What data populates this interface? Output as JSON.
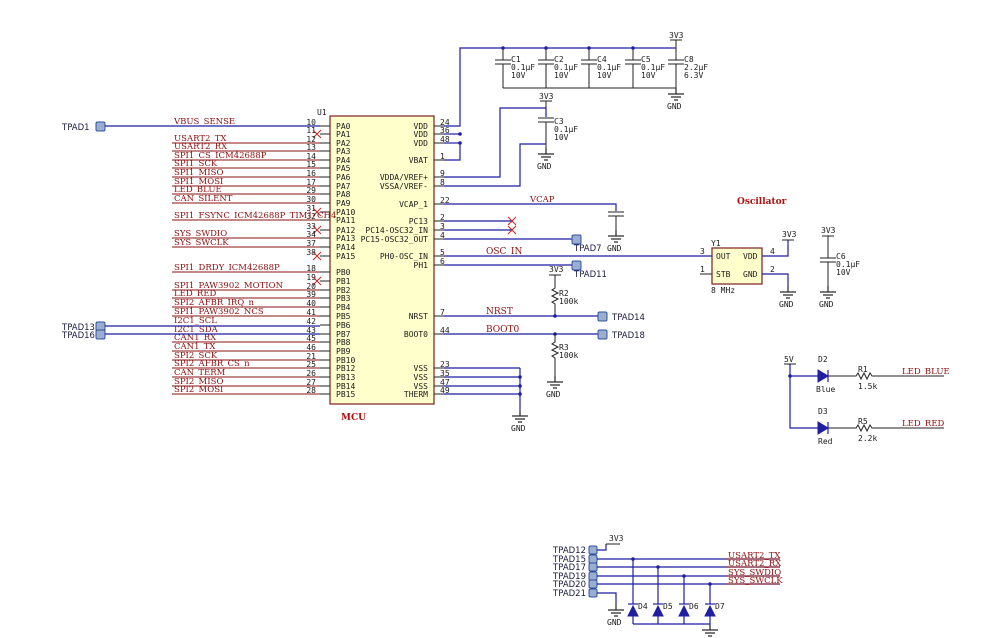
{
  "mcu": {
    "ref": "U1",
    "title": "MCU",
    "left_pins": [
      {
        "name": "PA0",
        "num": "10",
        "net": "VBUS_SENSE"
      },
      {
        "name": "PA1",
        "num": "11",
        "net": ""
      },
      {
        "name": "PA2",
        "num": "12",
        "net": "USART2_TX"
      },
      {
        "name": "PA3",
        "num": "13",
        "net": "USART2_RX"
      },
      {
        "name": "PA4",
        "num": "14",
        "net": "SPI1_CS_ICM42688P"
      },
      {
        "name": "PA5",
        "num": "15",
        "net": "SPI1_SCK"
      },
      {
        "name": "PA6",
        "num": "16",
        "net": "SPI1_MISO"
      },
      {
        "name": "PA7",
        "num": "17",
        "net": "SPI1_MOSI"
      },
      {
        "name": "PA8",
        "num": "29",
        "net": "LED_BLUE"
      },
      {
        "name": "PA9",
        "num": "30",
        "net": "CAN_SILENT"
      },
      {
        "name": "PA10",
        "num": "31",
        "net": ""
      },
      {
        "name": "PA11",
        "num": "32",
        "net": "SPI1_FSYNC_ICM42688P_TIM1_CH4"
      },
      {
        "name": "PA12",
        "num": "33",
        "net": ""
      },
      {
        "name": "PA13",
        "num": "34",
        "net": "SYS_SWDIO"
      },
      {
        "name": "PA14",
        "num": "37",
        "net": "SYS_SWCLK"
      },
      {
        "name": "PA15",
        "num": "38",
        "net": ""
      },
      {
        "name": "PB0",
        "num": "18",
        "net": "SPI1_DRDY_ICM42688P"
      },
      {
        "name": "PB1",
        "num": "19",
        "net": ""
      },
      {
        "name": "PB2",
        "num": "20",
        "net": "SPI1_PAW3902_MOTION"
      },
      {
        "name": "PB3",
        "num": "39",
        "net": "LED_RED"
      },
      {
        "name": "PB4",
        "num": "40",
        "net": "SPI2_AFBR_IRQ_n"
      },
      {
        "name": "PB5",
        "num": "41",
        "net": "SPI1_PAW3902_NCS"
      },
      {
        "name": "PB6",
        "num": "42",
        "net": "I2C1_SCL"
      },
      {
        "name": "PB7",
        "num": "43",
        "net": "I2C1_SDA"
      },
      {
        "name": "PB8",
        "num": "45",
        "net": "CAN1_RX"
      },
      {
        "name": "PB9",
        "num": "46",
        "net": "CAN1_TX"
      },
      {
        "name": "PB10",
        "num": "21",
        "net": "SPI2_SCK"
      },
      {
        "name": "PB12",
        "num": "25",
        "net": "SPI2_AFBR_CS_n"
      },
      {
        "name": "PB13",
        "num": "26",
        "net": "CAN_TERM"
      },
      {
        "name": "PB14",
        "num": "27",
        "net": "SPI2_MISO"
      },
      {
        "name": "PB15",
        "num": "28",
        "net": "SPI2_MOSI"
      }
    ],
    "right_pins": [
      {
        "name": "VDD",
        "num": "24"
      },
      {
        "name": "VDD",
        "num": "36"
      },
      {
        "name": "VDD",
        "num": "48"
      },
      {
        "name": "VBAT",
        "num": "1"
      },
      {
        "name": "VDDA/VREF+",
        "num": "9"
      },
      {
        "name": "VSSA/VREF-",
        "num": "8"
      },
      {
        "name": "VCAP_1",
        "num": "22"
      },
      {
        "name": "PC13",
        "num": "2"
      },
      {
        "name": "PC14-OSC32_IN",
        "num": "3"
      },
      {
        "name": "PC15-OSC32_OUT",
        "num": "4"
      },
      {
        "name": "PH0-OSC_IN",
        "num": "5"
      },
      {
        "name": "PH1",
        "num": "6"
      },
      {
        "name": "NRST",
        "num": "7"
      },
      {
        "name": "BOOT0",
        "num": "44"
      },
      {
        "name": "VSS",
        "num": "23"
      },
      {
        "name": "VSS",
        "num": "35"
      },
      {
        "name": "VSS",
        "num": "47"
      },
      {
        "name": "THERM",
        "num": "49"
      }
    ]
  },
  "left_testpoints": {
    "tpad1": "TPAD1",
    "tpad13": "TPAD13",
    "tpad16": "TPAD16"
  },
  "right_nets": {
    "vcap": "VCAP",
    "osc_in": "OSC_IN",
    "nrst": "NRST",
    "boot0": "BOOT0",
    "tpad7": "TPAD7",
    "tpad11": "TPAD11",
    "tpad14": "TPAD14",
    "tpad18": "TPAD18"
  },
  "caps_top": [
    {
      "ref": "C1",
      "value": "0.1µF",
      "volt": "10V"
    },
    {
      "ref": "C2",
      "value": "0.1µF",
      "volt": "10V"
    },
    {
      "ref": "C4",
      "value": "0.1µF",
      "volt": "10V"
    },
    {
      "ref": "C5",
      "value": "0.1µF",
      "volt": "10V"
    },
    {
      "ref": "C8",
      "value": "2.2µF",
      "volt": "6.3V"
    }
  ],
  "c3": {
    "ref": "C3",
    "value": "0.1µF",
    "volt": "10V"
  },
  "c6": {
    "ref": "C6",
    "value": "0.1µF",
    "volt": "10V"
  },
  "r2": {
    "ref": "R2",
    "value": "100k"
  },
  "r3": {
    "ref": "R3",
    "value": "100k"
  },
  "power": {
    "v3": "3V3",
    "v5": "5V",
    "gnd": "GND"
  },
  "osc": {
    "title": "Oscillator",
    "ref": "Y1",
    "freq": "8 MHz",
    "pin_out": "OUT",
    "pin_stb": "STB",
    "pin_vdd": "VDD",
    "pin_gnd": "GND",
    "num_out": "3",
    "num_stb": "1",
    "num_vdd": "4",
    "num_gnd": "2"
  },
  "leds": [
    {
      "ref": "D2",
      "color": "Blue",
      "rref": "R1",
      "rval": "1.5k",
      "net": "LED_BLUE"
    },
    {
      "ref": "D3",
      "color": "Red",
      "rref": "R5",
      "rval": "2.2k",
      "net": "LED_RED"
    }
  ],
  "esd": {
    "tpads": [
      "TPAD12",
      "TPAD15",
      "TPAD17",
      "TPAD19",
      "TPAD20",
      "TPAD21"
    ],
    "nets": [
      "USART2_TX",
      "USART2_RX",
      "SYS_SWDIO",
      "SYS_SWCLK"
    ],
    "diodes": [
      "D4",
      "D5",
      "D6",
      "D7"
    ]
  }
}
